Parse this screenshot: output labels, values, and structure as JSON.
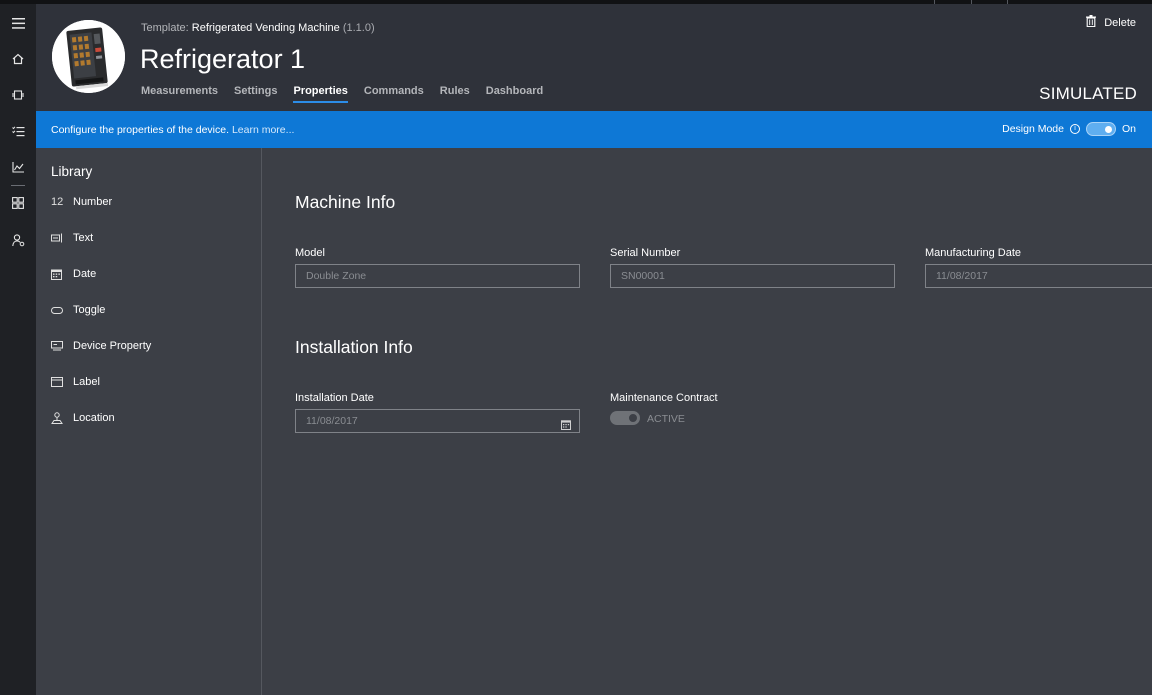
{
  "header": {
    "template_key": "Template:",
    "template_name": "Refrigerated Vending Machine",
    "template_version": "(1.1.0)",
    "device_title": "Refrigerator 1",
    "tabs": [
      {
        "label": "Measurements"
      },
      {
        "label": "Settings"
      },
      {
        "label": "Properties"
      },
      {
        "label": "Commands"
      },
      {
        "label": "Rules"
      },
      {
        "label": "Dashboard"
      }
    ],
    "active_tab": "Properties",
    "delete_label": "Delete",
    "status": "SIMULATED"
  },
  "banner": {
    "message": "Configure the properties of the device.",
    "learn_more": "Learn more...",
    "design_mode_label": "Design Mode",
    "design_mode_state": "On",
    "info_glyph": "i"
  },
  "library": {
    "title": "Library",
    "items": [
      {
        "label": "Number",
        "icon": "number-icon",
        "glyph": "12"
      },
      {
        "label": "Text",
        "icon": "text-icon"
      },
      {
        "label": "Date",
        "icon": "calendar-icon"
      },
      {
        "label": "Toggle",
        "icon": "toggle-icon"
      },
      {
        "label": "Device Property",
        "icon": "device-property-icon"
      },
      {
        "label": "Label",
        "icon": "label-icon"
      },
      {
        "label": "Location",
        "icon": "location-icon"
      }
    ]
  },
  "machine_info": {
    "title": "Machine Info",
    "model_label": "Model",
    "model_value": "Double Zone",
    "serial_label": "Serial Number",
    "serial_value": "SN00001",
    "mfg_label": "Manufacturing Date",
    "mfg_value": "11/08/2017"
  },
  "installation_info": {
    "title": "Installation Info",
    "install_date_label": "Installation Date",
    "install_date_value": "11/08/2017",
    "contract_label": "Maintenance Contract",
    "contract_state": "ACTIVE"
  },
  "colors": {
    "accent": "#0e78d6",
    "tab_underline": "#2c8de8",
    "header_bg": "#2f323a",
    "body_bg": "#3c3f46",
    "rail_bg": "#1f2125"
  }
}
